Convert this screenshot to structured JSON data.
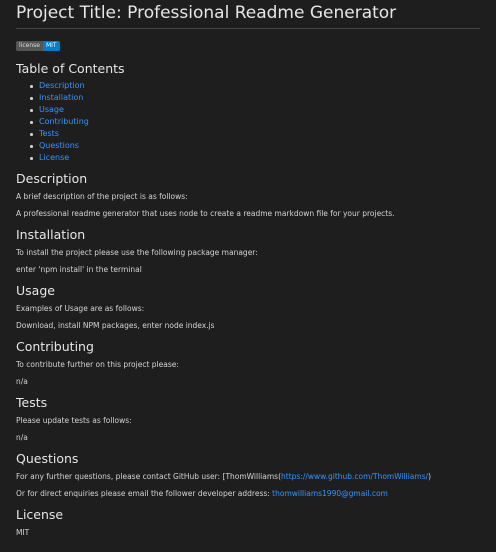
{
  "title": "Project Title: Professional Readme Generator",
  "badge": {
    "left": "license",
    "right": "MIT"
  },
  "toc": {
    "heading": "Table of Contents",
    "items": [
      "Description",
      "Installation",
      "Usage",
      "Contributing",
      "Tests",
      "Questions",
      "License"
    ]
  },
  "description": {
    "heading": "Description",
    "line1": "A brief description of the project is as follows:",
    "line2": "A professional readme generator that uses node to create a readme markdown file for your projects."
  },
  "installation": {
    "heading": "Installation",
    "line1": "To install the project please use the following package manager:",
    "line2": "enter 'npm install' in the terminal"
  },
  "usage": {
    "heading": "Usage",
    "line1": "Examples of Usage are as follows:",
    "line2": "Download, install NPM packages, enter node index.js"
  },
  "contributing": {
    "heading": "Contributing",
    "line1": "To contribute further on this project please:",
    "line2": "n/a"
  },
  "tests": {
    "heading": "Tests",
    "line1": "Please update tests as follows:",
    "line2": "n/a"
  },
  "questions": {
    "heading": "Questions",
    "line1_prefix": "For any further questions, please contact GitHub user: [ThomWilliams(",
    "github_link": "https://www.github.com/ThomWilliams/",
    "line1_suffix": ")",
    "line2_prefix": "Or for direct enquiries please email the follower developer address: ",
    "email_link": "thomwilliams1990@gmail.com"
  },
  "license": {
    "heading": "License",
    "text": "MIT"
  },
  "colors": {
    "link": "#3794ff",
    "background": "#1e1e1e",
    "text": "#d4d4d4"
  }
}
